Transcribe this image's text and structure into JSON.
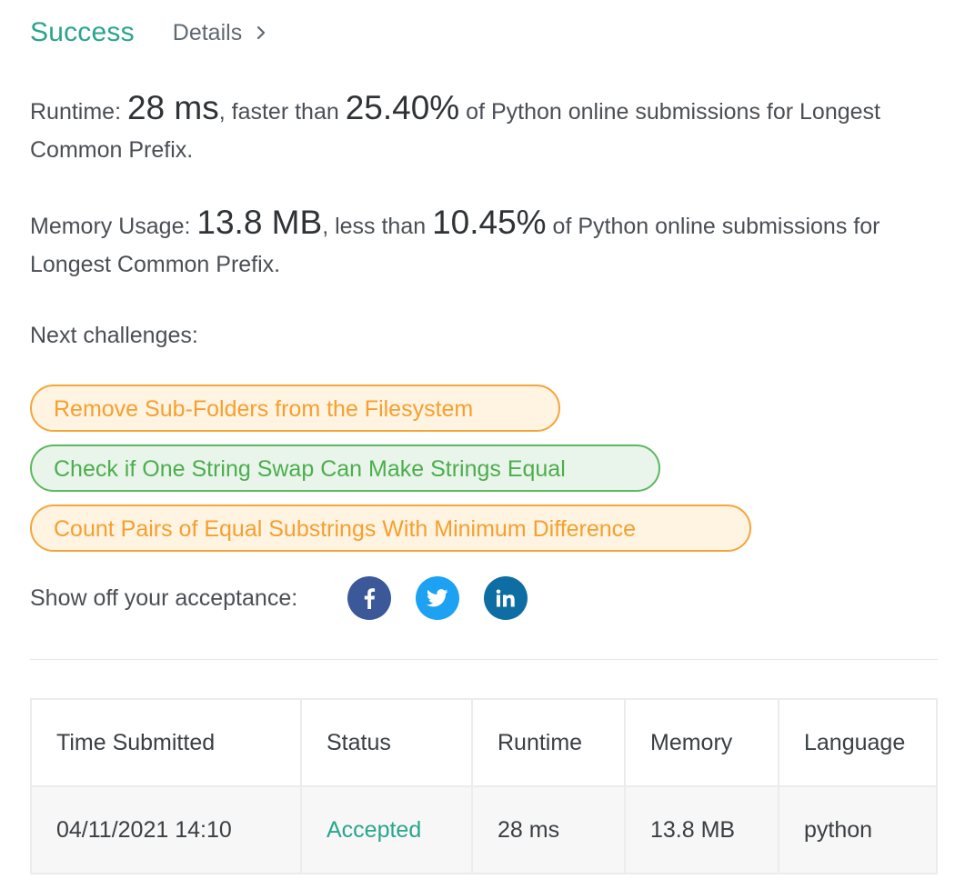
{
  "header": {
    "title": "Success",
    "details_label": "Details"
  },
  "runtime": {
    "label": "Runtime: ",
    "value": "28 ms",
    "mid": ", faster than ",
    "percent": "25.40%",
    "tail": " of Python online submissions for Longest Common Prefix."
  },
  "memory": {
    "label": "Memory Usage: ",
    "value": "13.8 MB",
    "mid": ", less than ",
    "percent": "10.45%",
    "tail": " of Python online submissions for Longest Common Prefix."
  },
  "next_challenges": {
    "label": "Next challenges:",
    "items": [
      {
        "label": "Remove Sub-Folders from the Filesystem",
        "difficulty": "orange"
      },
      {
        "label": "Check if One String Swap Can Make Strings Equal",
        "difficulty": "green"
      },
      {
        "label": "Count Pairs of Equal Substrings With Minimum Difference",
        "difficulty": "orange"
      }
    ]
  },
  "share": {
    "label": "Show off your acceptance:",
    "icons": [
      "facebook-icon",
      "twitter-icon",
      "linkedin-icon"
    ]
  },
  "table": {
    "headers": [
      "Time Submitted",
      "Status",
      "Runtime",
      "Memory",
      "Language"
    ],
    "rows": [
      [
        "04/11/2021 14:10",
        "Accepted",
        "28 ms",
        "13.8 MB",
        "python"
      ]
    ]
  },
  "colors": {
    "success": "#2aa58e",
    "orange": "#f5a53a",
    "green": "#5cb85c",
    "facebook": "#3b5998",
    "twitter": "#1da1f2",
    "linkedin": "#0e6ea3"
  }
}
